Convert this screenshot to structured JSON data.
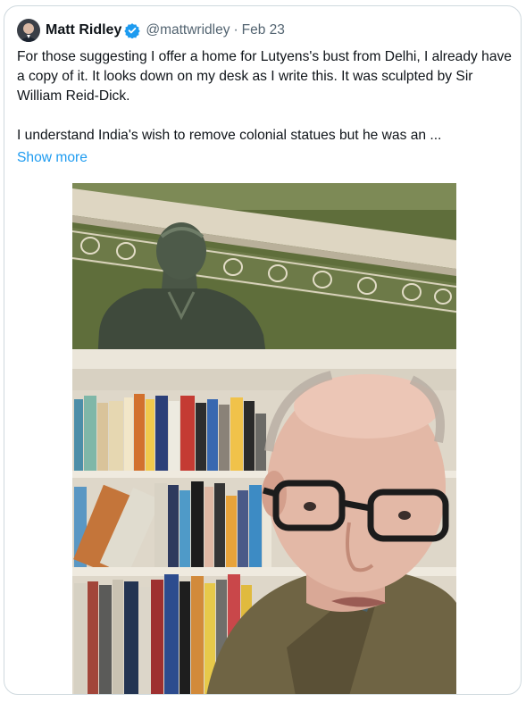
{
  "tweet": {
    "author_name": "Matt Ridley",
    "handle": "@mattwridley",
    "separator": "·",
    "date": "Feb 23",
    "verified": true,
    "paragraphs": [
      "For those suggesting I offer a home for Lutyens's bust from Delhi, I already have a copy of it. It looks down on my desk as I write this. It was sculpted by Sir William Reid-Dick.",
      "I understand India's wish to remove colonial statues but he was an ..."
    ],
    "show_more_label": "Show more"
  },
  "colors": {
    "link": "#1d9bf0",
    "verified": "#1d9bf0",
    "secondary_text": "#536471",
    "border": "#cfd9de"
  },
  "icons": {
    "verified": "verified-badge-icon"
  }
}
